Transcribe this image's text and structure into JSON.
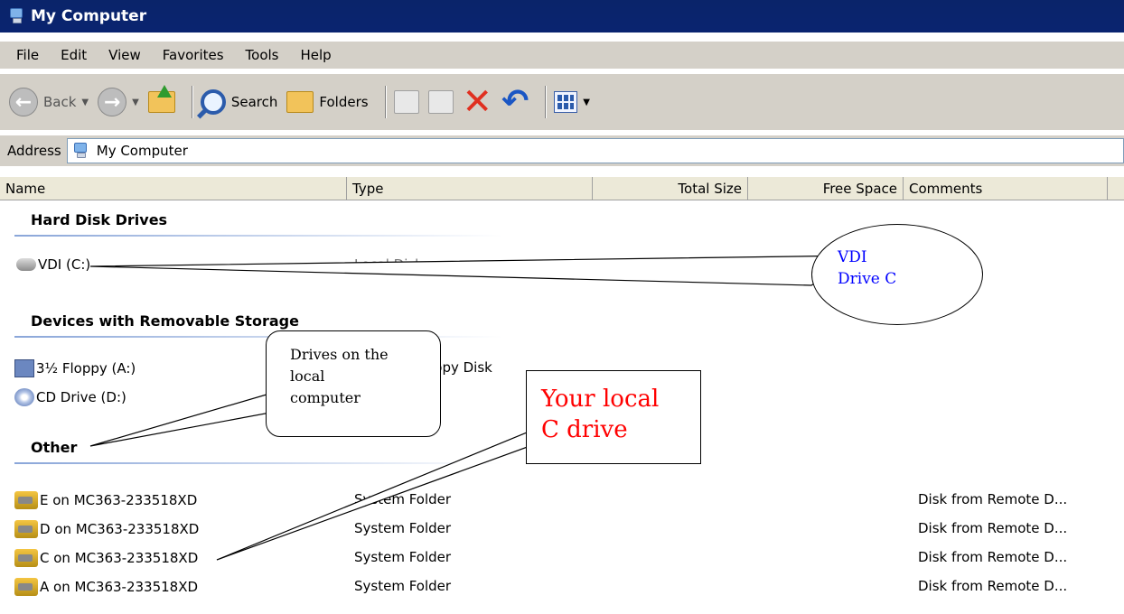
{
  "window": {
    "title": "My Computer"
  },
  "menu": [
    "File",
    "Edit",
    "View",
    "Favorites",
    "Tools",
    "Help"
  ],
  "toolbar": {
    "back_label": "Back",
    "search_label": "Search",
    "folders_label": "Folders"
  },
  "address": {
    "label": "Address",
    "value": "My Computer"
  },
  "columns": [
    "Name",
    "Type",
    "Total Size",
    "Free Space",
    "Comments"
  ],
  "groups": {
    "hard_disk": "Hard Disk Drives",
    "removable": "Devices with Removable Storage",
    "other": "Other"
  },
  "hard_disk_items": [
    {
      "name": "VDI (C:)",
      "type": "Local Disk",
      "total": "",
      "free": "",
      "comments": ""
    }
  ],
  "removable_items": [
    {
      "name": "3½ Floppy (A:)",
      "type": "3½-Inch Floppy Disk"
    },
    {
      "name": "CD Drive (D:)",
      "type": ""
    }
  ],
  "other_items": [
    {
      "name": "E on MC363-233518XD",
      "type": "System Folder",
      "comments": "Disk from Remote D..."
    },
    {
      "name": "D on MC363-233518XD",
      "type": "System Folder",
      "comments": "Disk from Remote D..."
    },
    {
      "name": "C on MC363-233518XD",
      "type": "System Folder",
      "comments": "Disk from Remote D..."
    },
    {
      "name": "A on MC363-233518XD",
      "type": "System Folder",
      "comments": "Disk from Remote D..."
    }
  ],
  "callouts": {
    "vdi_line1": "VDI",
    "vdi_line2": "Drive C",
    "drives_line1": "Drives on the",
    "drives_line2": "local",
    "drives_line3": "computer",
    "local_c_line1": "Your local",
    "local_c_line2": "C drive"
  },
  "colors": {
    "title_bar": "#0a246a",
    "chrome": "#d4d0c8",
    "callout_blue": "#0000ff",
    "callout_red": "#ff0000"
  }
}
